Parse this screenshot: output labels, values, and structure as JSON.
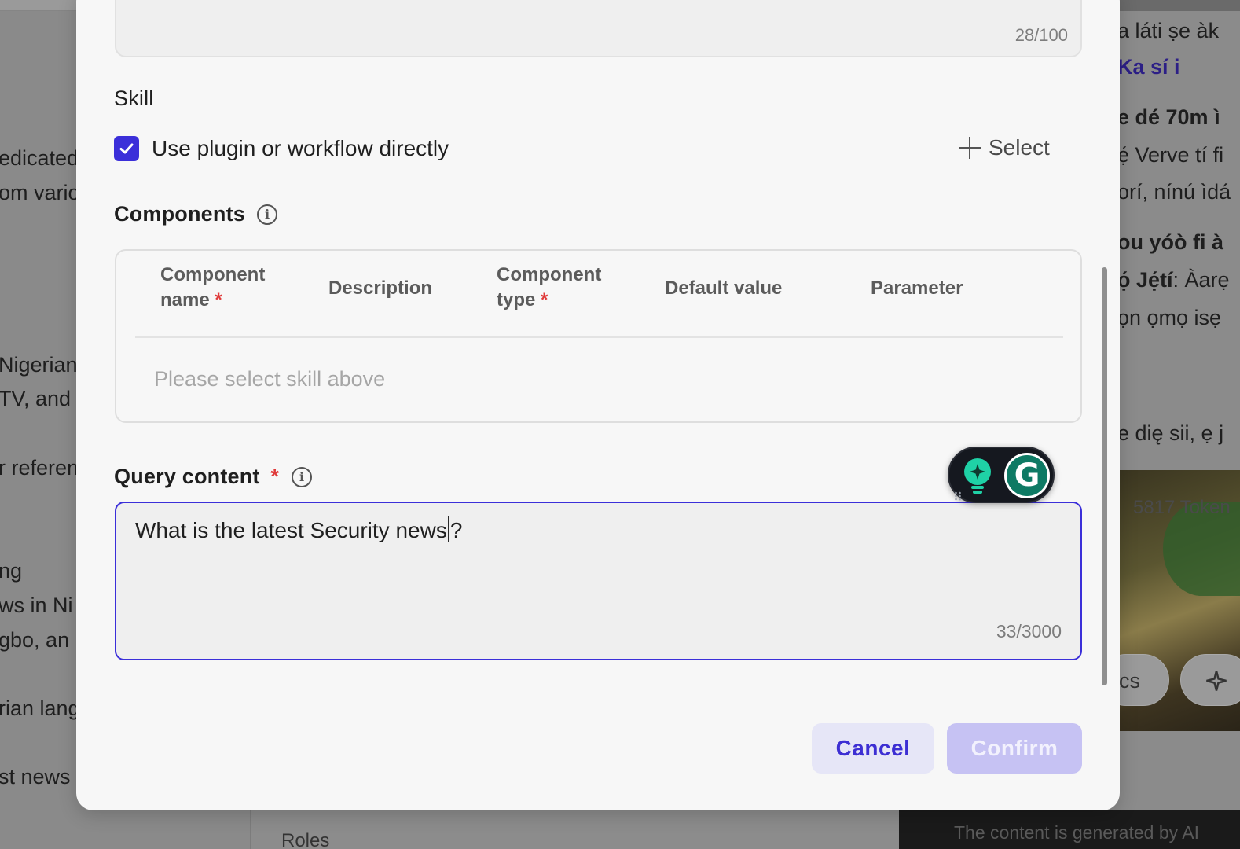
{
  "background": {
    "left_texts": [
      "edicated",
      "om vario",
      "Nigerian",
      " TV, and",
      "r referen",
      "ng",
      "ws in Ni",
      "gbo, an",
      "rian lang",
      "st news"
    ],
    "right_texts": [
      "a láti ṣe àk",
      "Ka sí i",
      "e dé 70m ì",
      "ẹ́ Verve tí fi",
      "orí, nínú ìdá",
      "ou yóò fi à",
      "ọ́ Jẹ́tí",
      ": Àarẹ",
      "ọn ọmọ isẹ",
      "e dię sii, ẹ j",
      "5817 Token",
      "cs"
    ],
    "bottom_label": "Roles",
    "footer_text": "The content is generated by AI"
  },
  "form": {
    "top_counter": "28/100",
    "skill_title": "Skill",
    "use_plugin_label": "Use plugin or workflow directly",
    "use_plugin_checked": true,
    "select_label": "Select",
    "components_title": "Components",
    "columns": {
      "component_name_line1": "Component",
      "component_name_line2": "name",
      "description": "Description",
      "component_type_line1": "Component",
      "component_type_line2": "type",
      "default_value": "Default value",
      "parameter": "Parameter"
    },
    "required_mark": "*",
    "empty_text": "Please select skill above",
    "query_title": "Query content",
    "query_value_before_caret": "What is the latest Security news",
    "query_value_after_caret": "?",
    "query_counter": "33/3000"
  },
  "buttons": {
    "cancel": "Cancel",
    "confirm": "Confirm"
  },
  "grammarly": {
    "letter": "G"
  },
  "colors": {
    "accent": "#3b2fd9",
    "required": "#e03a3a",
    "confirm_disabled_bg": "#c6c2f3",
    "cancel_bg": "#e6e6f7",
    "grammarly_green": "#0e7a64",
    "grammarly_bulb": "#1fd1a6"
  }
}
